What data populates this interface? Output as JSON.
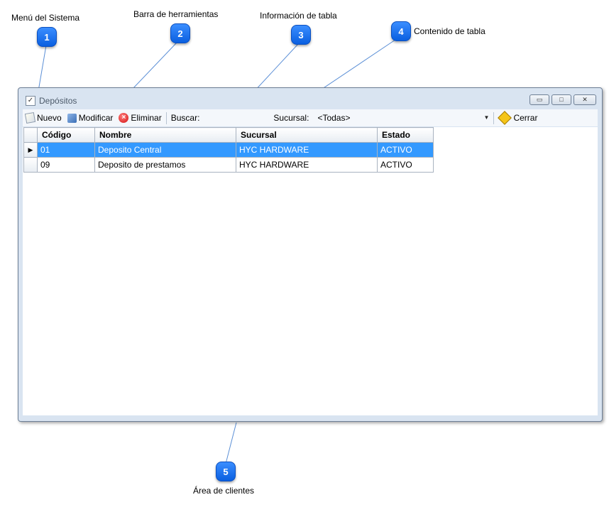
{
  "annotations": {
    "items": [
      {
        "number": "1",
        "label": "Menú del Sistema"
      },
      {
        "number": "2",
        "label": "Barra de herramientas"
      },
      {
        "number": "3",
        "label": "Información de tabla"
      },
      {
        "number": "4",
        "label": "Contenido de tabla"
      },
      {
        "number": "5",
        "label": "Área de clientes"
      }
    ]
  },
  "window": {
    "title": "Depósitos",
    "title_check": "✓",
    "buttons": {
      "minimize": "▭",
      "maximize": "□",
      "close": "✕"
    }
  },
  "toolbar": {
    "new_label": "Nuevo",
    "edit_label": "Modificar",
    "delete_label": "Eliminar",
    "search_label": "Buscar:",
    "search_value": "",
    "branch_label": "Sucursal:",
    "branch_value": "<Todas>",
    "close_label": "Cerrar",
    "icons": {
      "new": "new-document-icon",
      "edit": "edit-icon",
      "delete": "delete-icon",
      "close": "exit-icon"
    }
  },
  "grid": {
    "columns": [
      "Código",
      "Nombre",
      "Sucursal",
      "Estado"
    ],
    "rows": [
      {
        "codigo": "01",
        "nombre": "Deposito Central",
        "sucursal": "HYC HARDWARE",
        "estado": "ACTIVO",
        "selected": true
      },
      {
        "codigo": "09",
        "nombre": "Deposito de prestamos",
        "sucursal": "HYC HARDWARE",
        "estado": "ACTIVO",
        "selected": false
      }
    ],
    "current_row_marker": "▶"
  },
  "colors": {
    "accent": "#3399ff",
    "badge": "#1a6ff0",
    "window_bg": "#d9e4f1"
  }
}
